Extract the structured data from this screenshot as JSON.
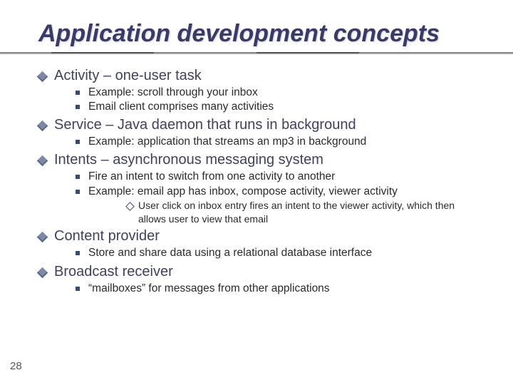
{
  "title": "Application development concepts",
  "page_number": "28",
  "items": [
    {
      "label": "Activity – one-user task",
      "sub": [
        {
          "label": "Example: scroll through your inbox"
        },
        {
          "label": "Email client comprises many activities"
        }
      ]
    },
    {
      "label": "Service – Java daemon that runs in background",
      "sub": [
        {
          "label": "Example: application that streams an mp3 in background"
        }
      ]
    },
    {
      "label": "Intents – asynchronous messaging system",
      "sub": [
        {
          "label": "Fire an intent to switch from one activity to another"
        },
        {
          "label": "Example: email app has inbox, compose activity, viewer activity",
          "sub": [
            {
              "label": "User click on inbox entry fires an intent to the viewer activity, which then allows user to view that email"
            }
          ]
        }
      ]
    },
    {
      "label": "Content provider",
      "sub": [
        {
          "label": "Store and share data using a relational database interface"
        }
      ]
    },
    {
      "label": "Broadcast receiver",
      "sub": [
        {
          "label": "“mailboxes” for messages from other applications"
        }
      ]
    }
  ]
}
